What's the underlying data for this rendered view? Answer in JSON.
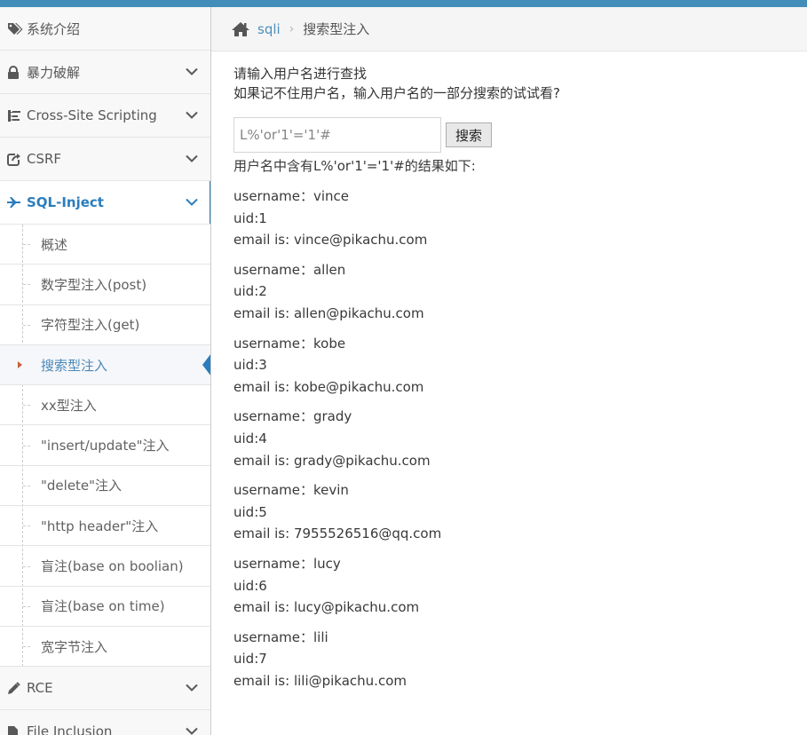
{
  "sidebar": {
    "items": [
      {
        "label": "系统介绍",
        "icon": "tags-icon"
      },
      {
        "label": "暴力破解",
        "icon": "lock-icon"
      },
      {
        "label": "Cross-Site Scripting",
        "icon": "sitemap-icon"
      },
      {
        "label": "CSRF",
        "icon": "share-icon"
      },
      {
        "label": "SQL-Inject",
        "icon": "plane-icon"
      }
    ],
    "submenu": [
      "概述",
      "数字型注入(post)",
      "字符型注入(get)",
      "搜索型注入",
      "xx型注入",
      "\"insert/update\"注入",
      "\"delete\"注入",
      "\"http header\"注入",
      "盲注(base on boolian)",
      "盲注(base on time)",
      "宽字节注入"
    ],
    "after": [
      {
        "label": "RCE",
        "icon": "pencil-icon"
      },
      {
        "label": "File Inclusion",
        "icon": "file-icon"
      }
    ]
  },
  "breadcrumb": {
    "link": "sqli",
    "current": "搜索型注入"
  },
  "main": {
    "hint_line1": "请输入用户名进行查找",
    "hint_line2": "如果记不住用户名，输入用户名的一部分搜索的试试看?",
    "search_value": "L%'or'1'='1'#",
    "search_button": "搜索",
    "result_title": "用户名中含有L%'or'1'='1'#的结果如下:",
    "results": [
      {
        "username": "username：vince",
        "uid": "uid:1",
        "email": "email is: vince@pikachu.com"
      },
      {
        "username": "username：allen",
        "uid": "uid:2",
        "email": "email is: allen@pikachu.com"
      },
      {
        "username": "username：kobe",
        "uid": "uid:3",
        "email": "email is: kobe@pikachu.com"
      },
      {
        "username": "username：grady",
        "uid": "uid:4",
        "email": "email is: grady@pikachu.com"
      },
      {
        "username": "username：kevin",
        "uid": "uid:5",
        "email": "email is: 7955526516@qq.com"
      },
      {
        "username": "username：lucy",
        "uid": "uid:6",
        "email": "email is: lucy@pikachu.com"
      },
      {
        "username": "username：lili",
        "uid": "uid:7",
        "email": "email is: lili@pikachu.com"
      }
    ]
  },
  "colors": {
    "accent": "#438eb9",
    "active_text": "#2b7dbc",
    "bullet": "#c86139"
  }
}
